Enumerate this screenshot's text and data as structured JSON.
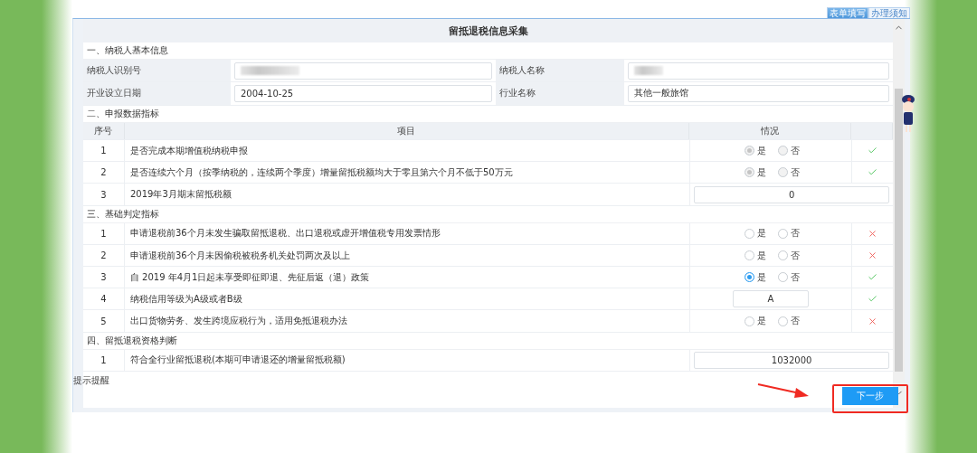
{
  "tabs": [
    {
      "label": "表单填写",
      "selected": true
    },
    {
      "label": "办理须知",
      "selected": false
    }
  ],
  "title": "留抵退税信息采集",
  "basic": {
    "heading": "一、纳税人基本信息",
    "rows": [
      [
        {
          "label": "纳税人识别号",
          "redacted": true
        },
        {
          "label": "纳税人名称",
          "redacted": true
        }
      ],
      [
        {
          "label": "开业设立日期",
          "value": "2004-10-25",
          "redacted": false
        },
        {
          "label": "行业名称",
          "value": "其他一般旅馆",
          "redacted": false
        }
      ]
    ]
  },
  "sections": [
    {
      "heading": "二、申报数据指标",
      "columns": [
        "序号",
        "项目",
        "情况"
      ],
      "rows": [
        {
          "no": "1",
          "item": "是否完成本期增值税纳税申报",
          "kind": "radio",
          "disabled": true,
          "options": [
            {
              "label": "是",
              "selected": true
            },
            {
              "label": "否",
              "selected": false
            }
          ],
          "valid": true
        },
        {
          "no": "2",
          "item": "是否连续六个月（按季纳税的，连续两个季度）增量留抵税额均大于零且第六个月不低于50万元",
          "kind": "radio",
          "disabled": true,
          "options": [
            {
              "label": "是",
              "selected": true
            },
            {
              "label": "否",
              "selected": false
            }
          ],
          "valid": true
        },
        {
          "no": "3",
          "item": "2019年3月期末留抵税额",
          "kind": "amount",
          "value": "0"
        }
      ]
    },
    {
      "heading": "三、基础判定指标",
      "rows": [
        {
          "no": "1",
          "item": "申请退税前36个月未发生骗取留抵退税、出口退税或虚开增值税专用发票情形",
          "kind": "radio",
          "disabled": false,
          "options": [
            {
              "label": "是",
              "selected": false
            },
            {
              "label": "否",
              "selected": false
            }
          ],
          "valid": false
        },
        {
          "no": "2",
          "item": "申请退税前36个月未因偷税被税务机关处罚两次及以上",
          "kind": "radio",
          "disabled": false,
          "options": [
            {
              "label": "是",
              "selected": false
            },
            {
              "label": "否",
              "selected": false
            }
          ],
          "valid": false
        },
        {
          "no": "3",
          "item": "自 2019 年4月1日起未享受即征即退、先征后返（退）政策",
          "kind": "radio",
          "disabled": false,
          "options": [
            {
              "label": "是",
              "selected": true
            },
            {
              "label": "否",
              "selected": false
            }
          ],
          "valid": true
        },
        {
          "no": "4",
          "item": "纳税信用等级为A级或者B级",
          "kind": "input",
          "value": "A",
          "valid": true
        },
        {
          "no": "5",
          "item": "出口货物劳务、发生跨境应税行为，适用免抵退税办法",
          "kind": "radio",
          "disabled": false,
          "options": [
            {
              "label": "是",
              "selected": false
            },
            {
              "label": "否",
              "selected": false
            }
          ],
          "valid": false
        }
      ]
    },
    {
      "heading": "四、留抵退税资格判断",
      "rows": [
        {
          "no": "1",
          "item": "符合全行业留抵退税(本期可申请退还的增量留抵税额)",
          "kind": "amount",
          "value": "1032000"
        }
      ]
    }
  ],
  "hint": "提示提醒",
  "next_button": "下一步"
}
